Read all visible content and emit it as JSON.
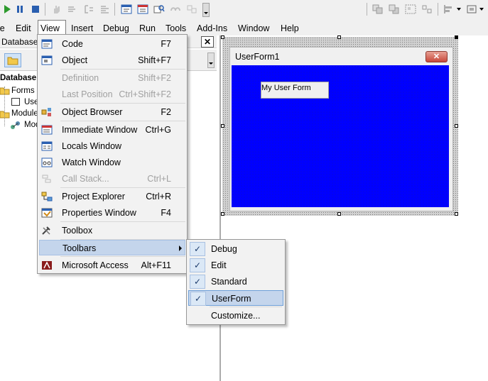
{
  "menubar": {
    "items": [
      "le",
      "Edit",
      "View",
      "Insert",
      "Debug",
      "Run",
      "Tools",
      "Add-Ins",
      "Window",
      "Help"
    ]
  },
  "left_panel": {
    "title": "Database",
    "close": "✕",
    "tree": [
      "Database",
      "Forms",
      "User",
      "Modules",
      "Mod"
    ]
  },
  "userform": {
    "title": "UserForm1",
    "close": "✕",
    "label": "My User Form",
    "back_color": "#0000ff"
  },
  "view_menu": {
    "items": [
      {
        "label": "Code",
        "shortcut": "F7",
        "icon": "code-window-icon",
        "disabled": false
      },
      {
        "label": "Object",
        "shortcut": "Shift+F7",
        "icon": "object-icon",
        "disabled": false
      },
      {
        "label": "Definition",
        "shortcut": "Shift+F2",
        "icon": "",
        "disabled": true
      },
      {
        "label": "Last Position",
        "shortcut": "Ctrl+Shift+F2",
        "icon": "",
        "disabled": true
      },
      {
        "label": "Object Browser",
        "shortcut": "F2",
        "icon": "object-browser-icon",
        "disabled": false
      },
      {
        "label": "Immediate Window",
        "shortcut": "Ctrl+G",
        "icon": "immediate-window-icon",
        "disabled": false
      },
      {
        "label": "Locals Window",
        "shortcut": "",
        "icon": "locals-window-icon",
        "disabled": false
      },
      {
        "label": "Watch Window",
        "shortcut": "",
        "icon": "watch-window-icon",
        "disabled": false
      },
      {
        "label": "Call Stack...",
        "shortcut": "Ctrl+L",
        "icon": "call-stack-icon",
        "disabled": true
      },
      {
        "label": "Project Explorer",
        "shortcut": "Ctrl+R",
        "icon": "project-explorer-icon",
        "disabled": false
      },
      {
        "label": "Properties Window",
        "shortcut": "F4",
        "icon": "properties-window-icon",
        "disabled": false
      },
      {
        "label": "Toolbox",
        "shortcut": "",
        "icon": "toolbox-icon",
        "disabled": false
      },
      {
        "label": "Toolbars",
        "shortcut": "",
        "icon": "",
        "disabled": false
      },
      {
        "label": "Microsoft Access",
        "shortcut": "Alt+F11",
        "icon": "microsoft-access-icon",
        "disabled": false
      }
    ]
  },
  "toolbars_submenu": {
    "items": [
      {
        "label": "Debug",
        "checked": true
      },
      {
        "label": "Edit",
        "checked": true
      },
      {
        "label": "Standard",
        "checked": true
      },
      {
        "label": "UserForm",
        "checked": true
      },
      {
        "label": "Customize...",
        "checked": false
      }
    ],
    "check_glyph": "✓"
  }
}
